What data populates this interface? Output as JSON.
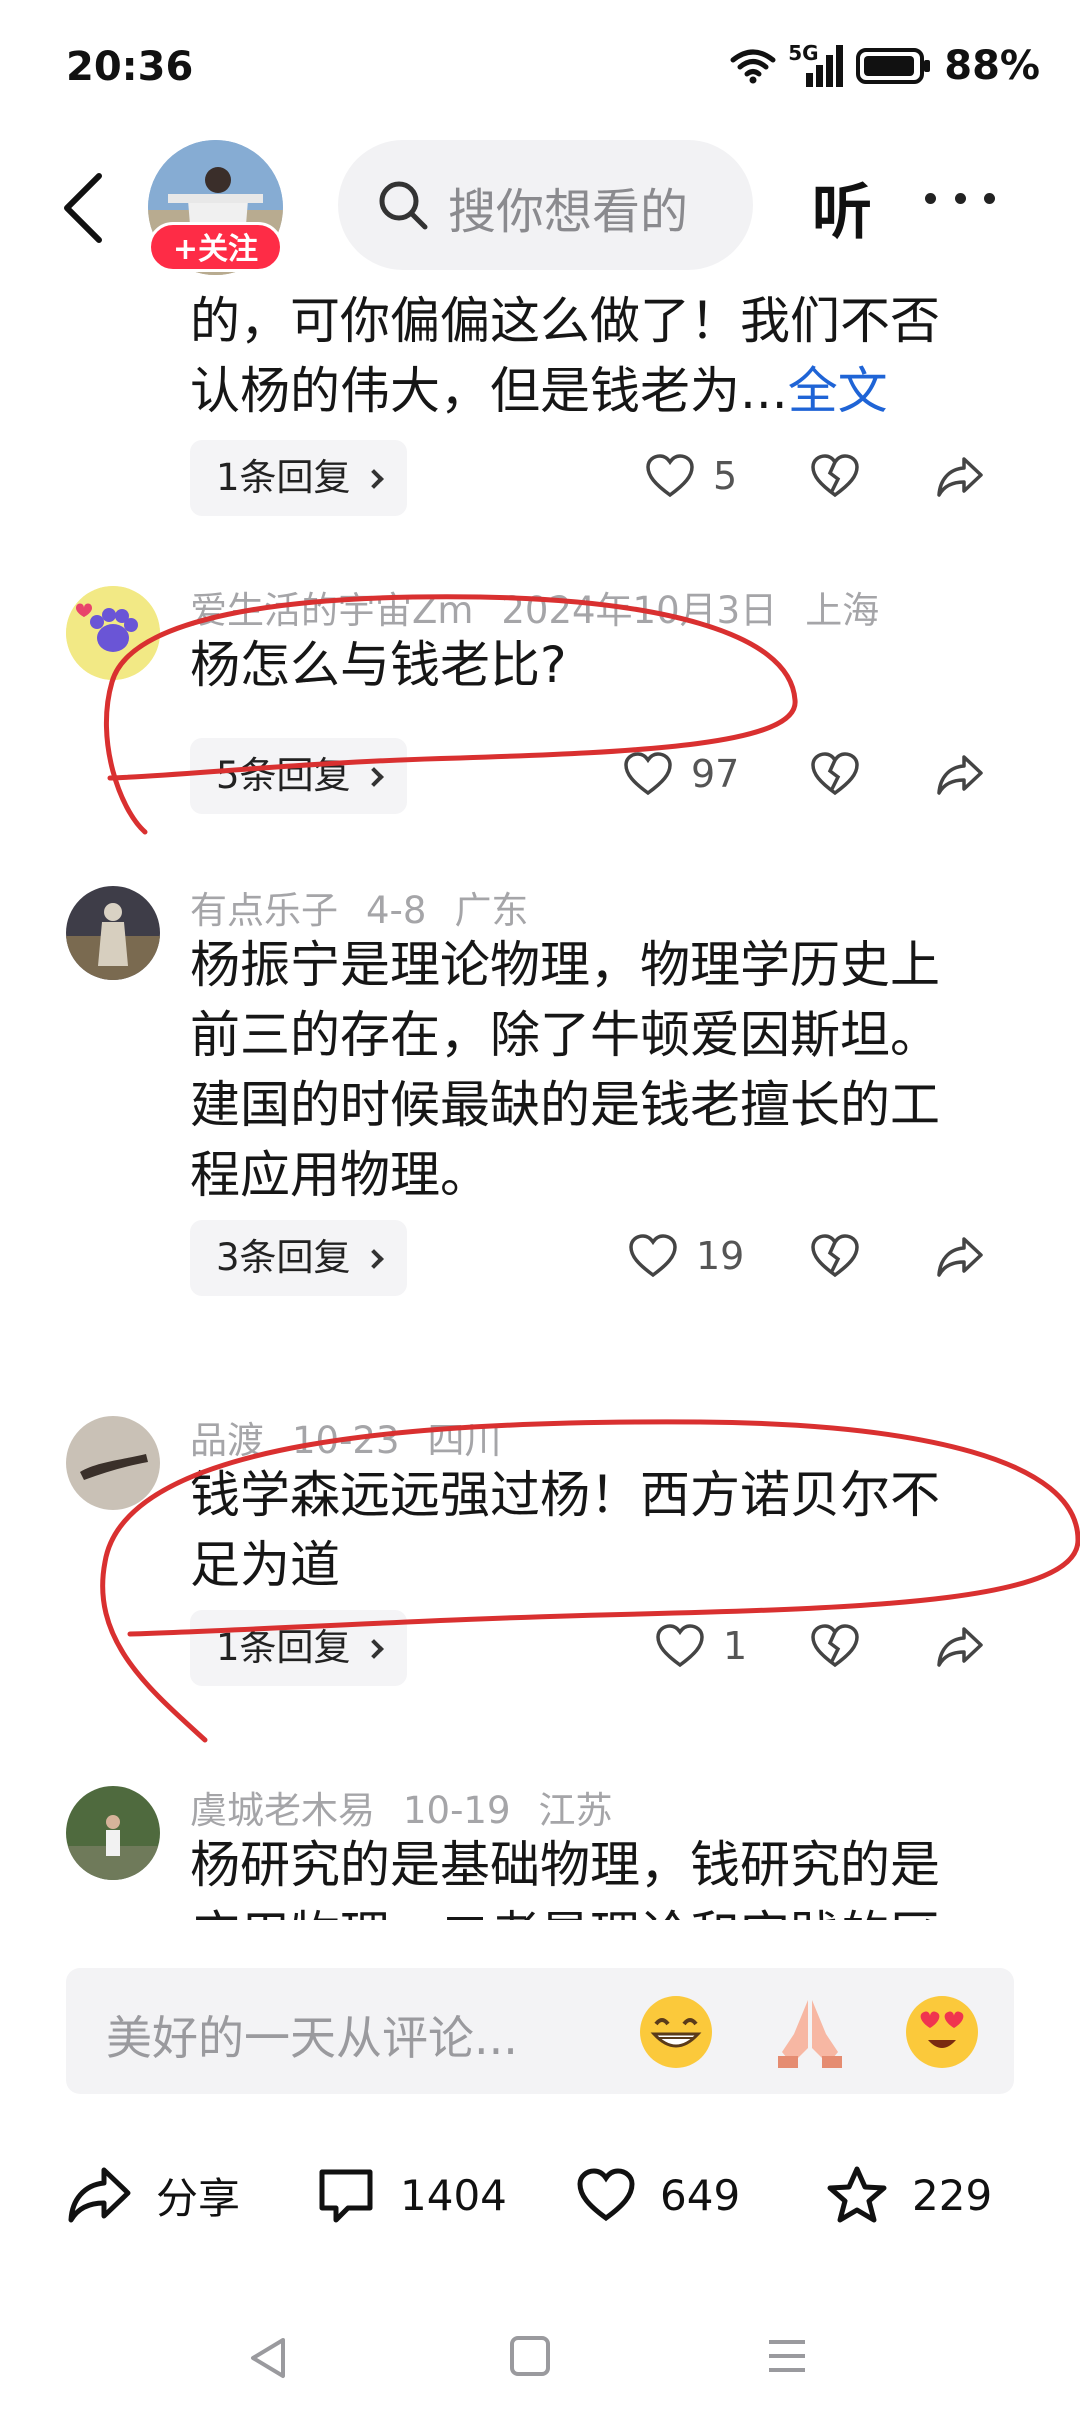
{
  "status": {
    "time": "20:36",
    "network": "5G",
    "battery": "88%"
  },
  "header": {
    "follow_label": "+关注",
    "search_placeholder": "搜你想看的",
    "listen_label": "听"
  },
  "comments": [
    {
      "text_lines": [
        "的，可你偏偏这么做了！我们不否",
        "认杨的伟大，但是钱老为..."
      ],
      "more_label": "全文",
      "replies": "1条回复",
      "likes": "5"
    },
    {
      "user": "爱生活的宇宙Zm",
      "date": "2024年10月3日",
      "location": "上海",
      "text": "杨怎么与钱老比?",
      "replies": "5条回复",
      "likes": "97"
    },
    {
      "user": "有点乐子",
      "date": "4-8",
      "location": "广东",
      "text_lines": [
        "杨振宁是理论物理，物理学历史上",
        "前三的存在，除了牛顿爱因斯坦。",
        "建国的时候最缺的是钱老擅长的工",
        "程应用物理。"
      ],
      "replies": "3条回复",
      "likes": "19"
    },
    {
      "user": "品渡",
      "date": "10-23",
      "location": "四川",
      "text_lines": [
        "钱学森远远强过杨！西方诺贝尔不",
        "足为道"
      ],
      "replies": "1条回复",
      "likes": "1"
    },
    {
      "user": "虞城老木易",
      "date": "10-19",
      "location": "江苏",
      "text_lines": [
        "杨研究的是基础物理，钱研究的是",
        "应用物理，二者是理论和实践的区"
      ]
    }
  ],
  "input": {
    "placeholder": "美好的一天从评论..."
  },
  "actions": {
    "share_label": "分享",
    "comments_count": "1404",
    "likes_count": "649",
    "favorites_count": "229"
  },
  "colors": {
    "accent_red": "#fe2c46",
    "link_blue": "#1f64d6",
    "annotation_red": "#d93030"
  }
}
